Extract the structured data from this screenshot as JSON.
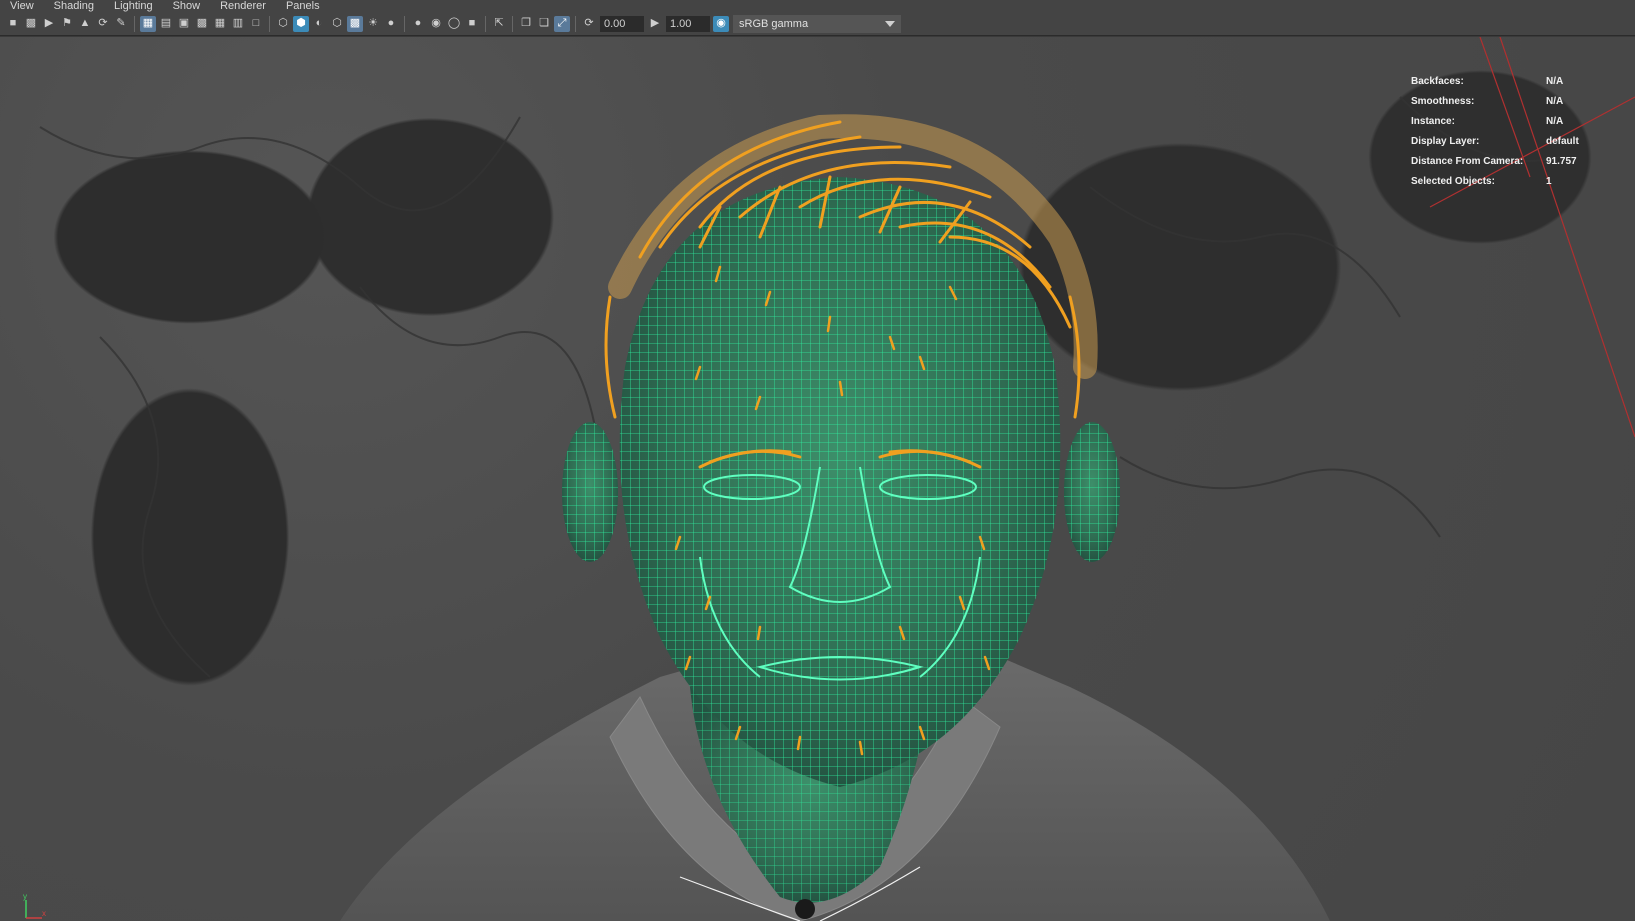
{
  "menu": {
    "items": [
      "View",
      "Shading",
      "Lighting",
      "Show",
      "Renderer",
      "Panels"
    ]
  },
  "toolbar": {
    "exposure_value": "0.00",
    "gamma_value": "1.00",
    "color_space": "sRGB gamma"
  },
  "hud": {
    "rows": [
      {
        "label": "Backfaces:",
        "value": "N/A"
      },
      {
        "label": "Smoothness:",
        "value": "N/A"
      },
      {
        "label": "Instance:",
        "value": "N/A"
      },
      {
        "label": "Display Layer:",
        "value": "default"
      },
      {
        "label": "Distance From Camera:",
        "value": "91.757"
      },
      {
        "label": "Selected Objects:",
        "value": "1"
      }
    ]
  },
  "axis": {
    "y_label": "y",
    "x_label": "x"
  },
  "colors": {
    "wireframe": "#2ef0a0",
    "hair": "#f0a020",
    "ui_bg": "#444444",
    "viewport_bg": "#4a4a4a",
    "active_button": "#3c8bb8"
  },
  "icons": {
    "toolbar": [
      "camera-icon",
      "camera-attributes-icon",
      "camera-bookmark-icon",
      "bookmark-icon",
      "image-plane-icon",
      "2d-pan-zoom-icon",
      "grease-pencil-icon",
      "grid-icon",
      "film-gate-icon",
      "resolution-gate-icon",
      "gate-mask-icon",
      "field-chart-icon",
      "safe-action-icon",
      "safe-title-icon",
      "wireframe-icon",
      "smooth-shade-icon",
      "default-material-icon",
      "wireframe-on-shaded-icon",
      "xray-icon",
      "use-all-lights-icon",
      "shadows-icon",
      "screen-space-ao-icon",
      "motion-blur-icon",
      "anti-aliasing-icon",
      "depth-of-field-icon",
      "isolate-select-icon",
      "xray-joints-icon",
      "xray-active-components-icon",
      "exposure-icon",
      "gamma-icon",
      "color-management-icon"
    ]
  }
}
